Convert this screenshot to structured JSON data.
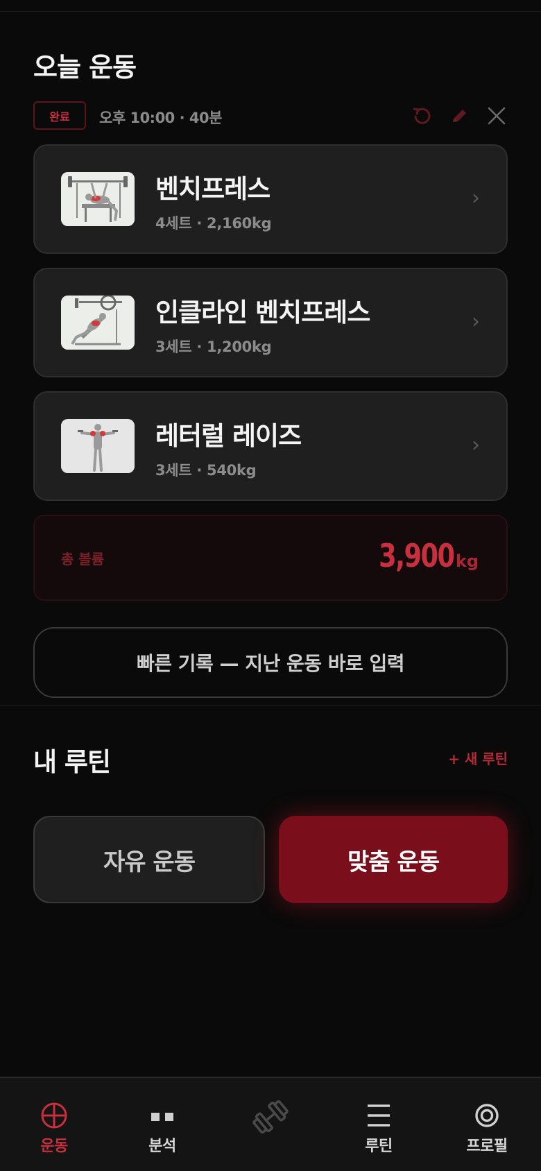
{
  "colors": {
    "accent": "#c8303d",
    "accent_dark": "#7a0f1b",
    "background": "#0a0a0a",
    "card": "#1f1f1f",
    "muted_text": "#8c8c8c"
  },
  "today": {
    "title": "오늘 운동",
    "status_badge": "완료",
    "time_info": "오후 10:00 · 40분",
    "actions": [
      {
        "icon": "undo-icon"
      },
      {
        "icon": "pencil-icon"
      },
      {
        "icon": "close-icon"
      }
    ]
  },
  "exercises": [
    {
      "name": "벤치프레스",
      "meta": "4세트 · 2,160kg",
      "thumb_icon": "bench-press-illustration"
    },
    {
      "name": "인클라인 벤치프레스",
      "meta": "3세트 · 1,200kg",
      "thumb_icon": "incline-bench-press-illustration"
    },
    {
      "name": "레터럴 레이즈",
      "meta": "3세트 · 540kg",
      "thumb_icon": "lateral-raise-illustration"
    }
  ],
  "chevron": "›",
  "volume": {
    "label": "총 볼륨",
    "value": "3,900",
    "unit": "kg"
  },
  "quick_record_label": "빠른 기록 — 지난 운동 바로 입력",
  "routines": {
    "title": "내 루틴",
    "new_label": "+ 새 루틴",
    "free_label": "자유 운동",
    "custom_label": "맞춤 운동"
  },
  "tabbar": {
    "tabs": [
      {
        "label": "운동",
        "icon": "crosshair-icon",
        "active": true
      },
      {
        "label": "분석",
        "icon": "chart-dots-icon",
        "active": false
      },
      {
        "label": "",
        "icon": "dumbbell-icon",
        "active": false
      },
      {
        "label": "루틴",
        "icon": "list-icon",
        "active": false
      },
      {
        "label": "프로필",
        "icon": "profile-ring-icon",
        "active": false
      }
    ]
  }
}
